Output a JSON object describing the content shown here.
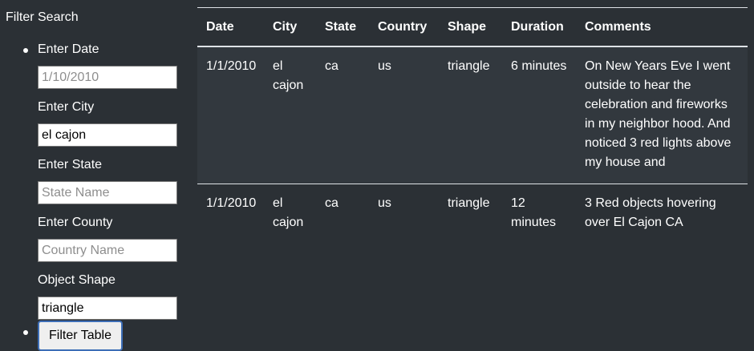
{
  "sidebar": {
    "title": "Filter Search",
    "fields": [
      {
        "label": "Enter Date",
        "value": "",
        "placeholder": "1/10/2010"
      },
      {
        "label": "Enter City",
        "value": "el cajon",
        "placeholder": ""
      },
      {
        "label": "Enter State",
        "value": "",
        "placeholder": "State Name"
      },
      {
        "label": "Enter County",
        "value": "",
        "placeholder": "Country Name"
      },
      {
        "label": "Object Shape",
        "value": "triangle",
        "placeholder": ""
      }
    ],
    "button_label": "Filter Table"
  },
  "table": {
    "headers": [
      "Date",
      "City",
      "State",
      "Country",
      "Shape",
      "Duration",
      "Comments"
    ],
    "rows": [
      [
        "1/1/2010",
        "el cajon",
        "ca",
        "us",
        "triangle",
        "6 minutes",
        "On New Years Eve I went outside to hear the celebration and fireworks in my neighbor hood. And noticed 3 red lights above my house and"
      ],
      [
        "1/1/2010",
        "el cajon",
        "ca",
        "us",
        "triangle",
        "12 minutes",
        "3 Red objects hovering over El Cajon CA"
      ]
    ]
  },
  "colors": {
    "background": "#2b3035",
    "row_stripe": "#32383e",
    "border": "#dee2e6",
    "button_focus": "#3d6eb7"
  }
}
